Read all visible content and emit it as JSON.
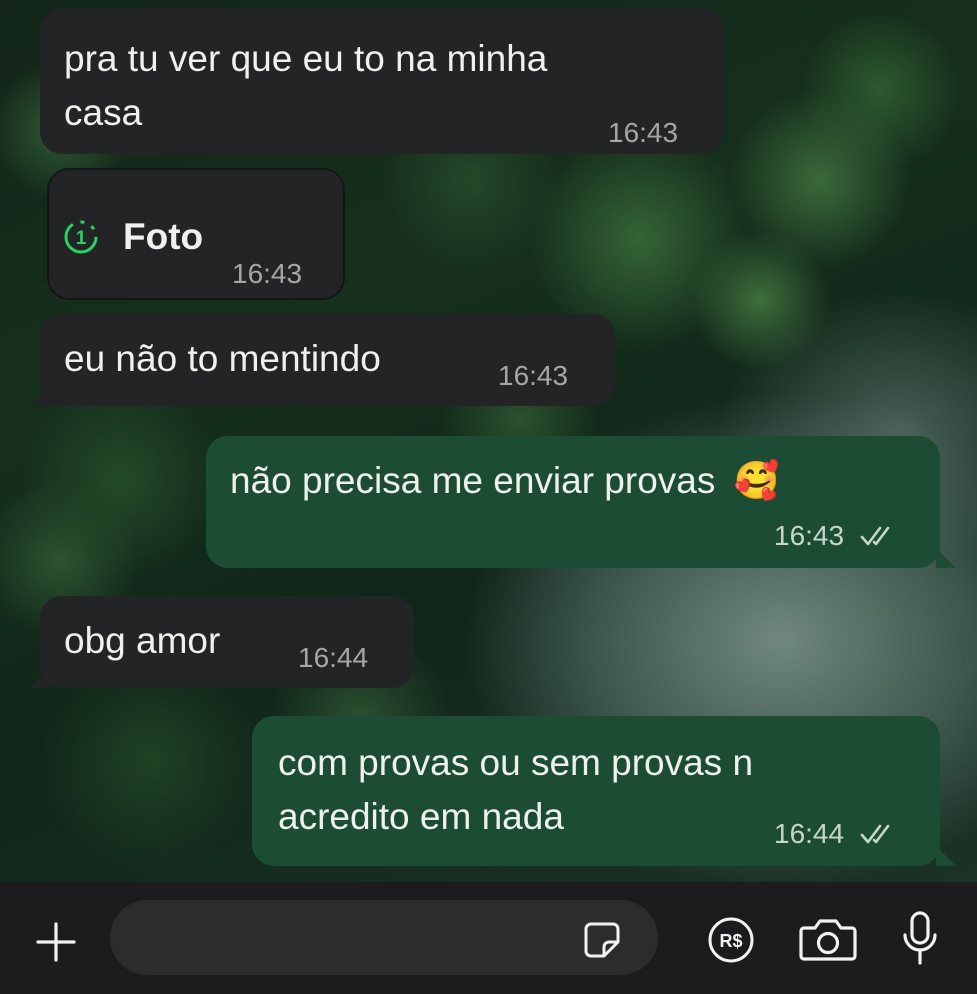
{
  "chat": {
    "messages": [
      {
        "direction": "incoming",
        "line1": "pra tu ver que eu to na minha",
        "line2": "casa",
        "time": "16:43"
      },
      {
        "direction": "incoming",
        "type": "view-once-photo",
        "badge": "1",
        "text": "Foto",
        "time": "16:43"
      },
      {
        "direction": "incoming",
        "text": "eu não to mentindo",
        "time": "16:43"
      },
      {
        "direction": "outgoing",
        "text": "não precisa me enviar provas",
        "emoji": "🥰",
        "time": "16:43",
        "status": "read"
      },
      {
        "direction": "incoming",
        "text": "obg amor",
        "time": "16:44"
      },
      {
        "direction": "outgoing",
        "line1": "com provas ou sem provas n",
        "line2": "acredito em nada",
        "time": "16:44",
        "status": "read"
      }
    ]
  },
  "composer": {
    "payment_label": "R$"
  },
  "colors": {
    "incoming_bubble": "#232425",
    "outgoing_bubble": "#1c4d34",
    "view_once_accent": "#25d366",
    "composer_bg": "#1c1c1e"
  },
  "icons": [
    "plus-icon",
    "sticker-icon",
    "payment-icon",
    "camera-icon",
    "microphone-icon",
    "double-check-icon",
    "view-once-icon"
  ]
}
